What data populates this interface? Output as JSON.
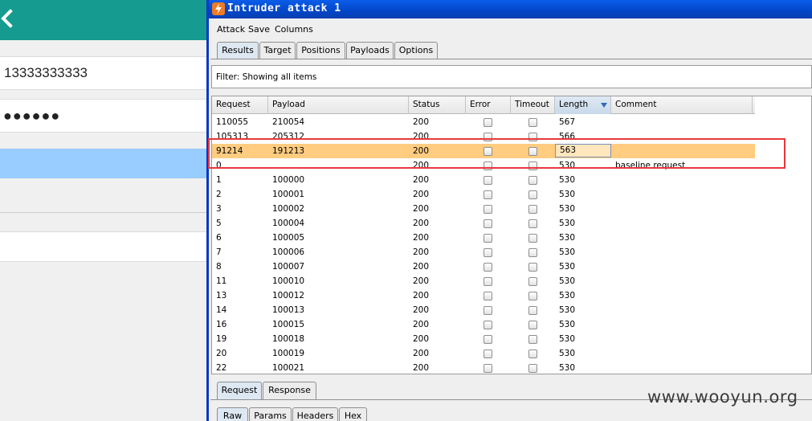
{
  "phone": {
    "phone_number": "13333333333",
    "password_mask": "●●●●●●",
    "appbar_color": "#159b8f"
  },
  "window": {
    "title": "Intruder attack 1",
    "icon": "burp-lightning-icon",
    "menu": [
      "Attack",
      "Save",
      "Columns"
    ]
  },
  "tabs": {
    "main": [
      "Results",
      "Target",
      "Positions",
      "Payloads",
      "Options"
    ],
    "active_main": "Results",
    "sub": [
      "Request",
      "Response"
    ],
    "active_sub": "Request",
    "view": [
      "Raw",
      "Params",
      "Headers",
      "Hex"
    ],
    "active_view": "Raw"
  },
  "filter": {
    "text": "Filter:  Showing all items"
  },
  "table": {
    "columns": [
      "Request",
      "Payload",
      "Status",
      "Error",
      "Timeout",
      "Length",
      "Comment"
    ],
    "sorted_column": "Length",
    "rows": [
      {
        "request": "110055",
        "payload": "210054",
        "status": "200",
        "length": "567",
        "comment": ""
      },
      {
        "request": "105313",
        "payload": "205312",
        "status": "200",
        "length": "566",
        "comment": ""
      },
      {
        "request": "91214",
        "payload": "191213",
        "status": "200",
        "length": "563",
        "comment": "",
        "selected": true
      },
      {
        "request": "0",
        "payload": "",
        "status": "200",
        "length": "530",
        "comment": "baseline request"
      },
      {
        "request": "1",
        "payload": "100000",
        "status": "200",
        "length": "530",
        "comment": ""
      },
      {
        "request": "2",
        "payload": "100001",
        "status": "200",
        "length": "530",
        "comment": ""
      },
      {
        "request": "3",
        "payload": "100002",
        "status": "200",
        "length": "530",
        "comment": ""
      },
      {
        "request": "5",
        "payload": "100004",
        "status": "200",
        "length": "530",
        "comment": ""
      },
      {
        "request": "6",
        "payload": "100005",
        "status": "200",
        "length": "530",
        "comment": ""
      },
      {
        "request": "7",
        "payload": "100006",
        "status": "200",
        "length": "530",
        "comment": ""
      },
      {
        "request": "8",
        "payload": "100007",
        "status": "200",
        "length": "530",
        "comment": ""
      },
      {
        "request": "11",
        "payload": "100010",
        "status": "200",
        "length": "530",
        "comment": ""
      },
      {
        "request": "13",
        "payload": "100012",
        "status": "200",
        "length": "530",
        "comment": ""
      },
      {
        "request": "14",
        "payload": "100013",
        "status": "200",
        "length": "530",
        "comment": ""
      },
      {
        "request": "16",
        "payload": "100015",
        "status": "200",
        "length": "530",
        "comment": ""
      },
      {
        "request": "19",
        "payload": "100018",
        "status": "200",
        "length": "530",
        "comment": ""
      },
      {
        "request": "20",
        "payload": "100019",
        "status": "200",
        "length": "530",
        "comment": ""
      },
      {
        "request": "22",
        "payload": "100021",
        "status": "200",
        "length": "530",
        "comment": ""
      }
    ]
  },
  "highlight_color": "#e8383d",
  "watermark": "www.wooyun.org"
}
